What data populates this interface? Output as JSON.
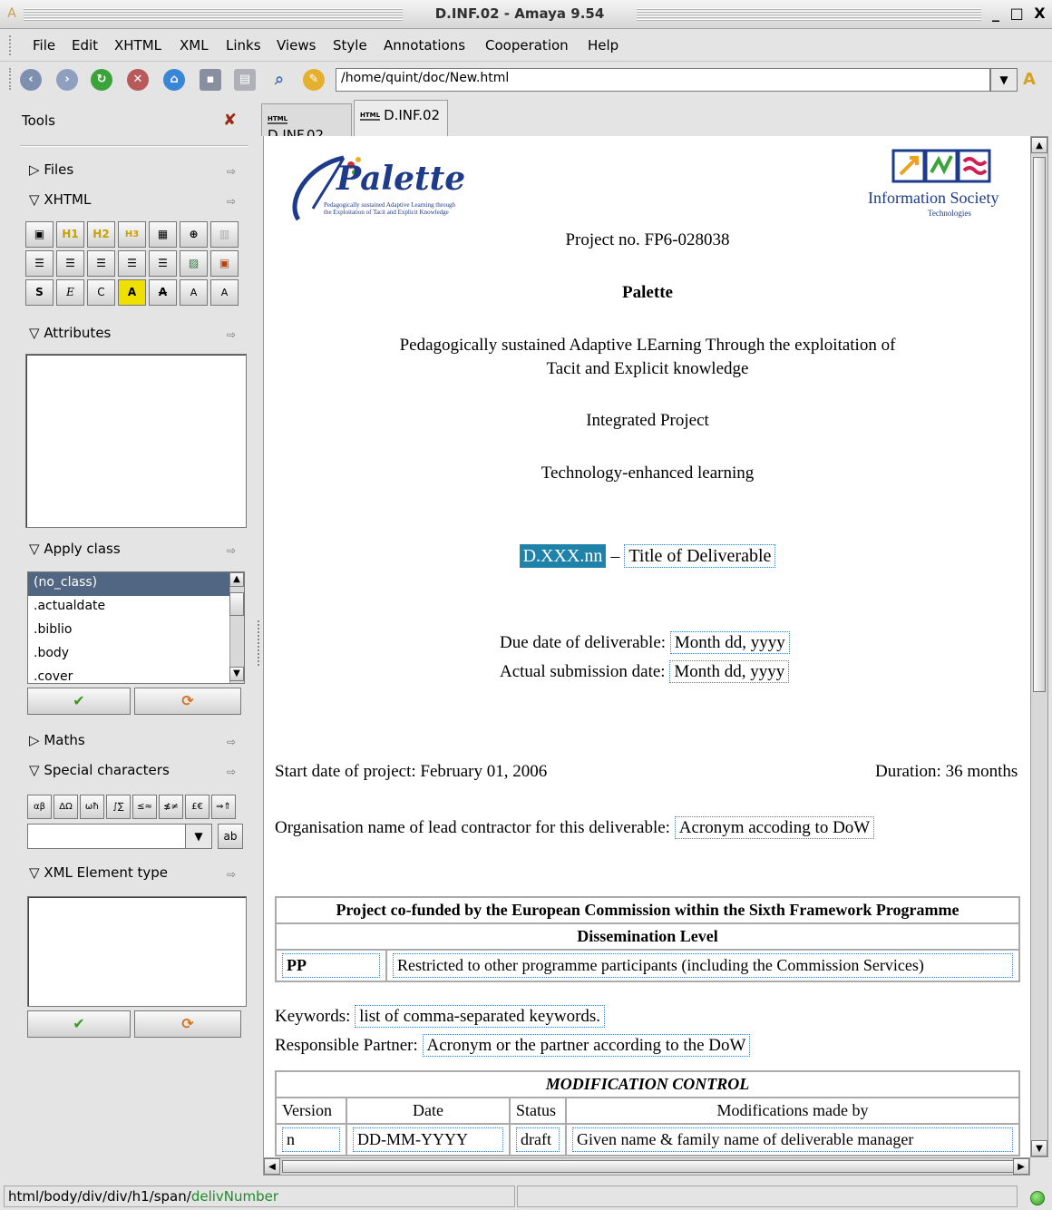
{
  "window": {
    "title": "D.INF.02 - Amaya 9.54",
    "controls": "_ □ X"
  },
  "menu": [
    "File",
    "Edit",
    "XHTML",
    "XML",
    "Links",
    "Views",
    "Style",
    "Annotations",
    "Cooperation",
    "Help"
  ],
  "toolbar": {
    "url": "/home/quint/doc/New.html",
    "icons": [
      "back-icon",
      "forward-icon",
      "reload-icon",
      "stop-icon",
      "home-icon",
      "save-icon",
      "print-icon",
      "find-icon",
      "spellcheck-icon",
      "style-icon"
    ]
  },
  "tools": {
    "title": "Tools",
    "sections": {
      "files": "Files",
      "xhtml": "XHTML",
      "attributes": "Attributes",
      "apply_class": "Apply class",
      "maths": "Maths",
      "special": "Special characters",
      "xml_type": "XML Element type"
    },
    "xhtml_buttons": [
      [
        "▣",
        "H1",
        "H2",
        "H3",
        "▦",
        "⊕",
        "▥"
      ],
      [
        "☰",
        "☰",
        "☰",
        "☰",
        "☰",
        "▨",
        "▣"
      ],
      [
        "S",
        "E",
        "C",
        "A",
        "A",
        "A",
        "A"
      ]
    ],
    "classes": [
      "(no_class)",
      ".actualdate",
      ".biblio",
      ".body",
      ".cover"
    ],
    "char_buttons": [
      "αβ",
      "ΔΩ",
      "ωħ",
      "∫∑",
      "≤≈",
      "≰≠",
      "£€",
      "⇒⇑"
    ]
  },
  "tabs": [
    "D.INF.02",
    "D.INF.02"
  ],
  "document": {
    "logo_left": "Palette",
    "logo_left_tagline1": "Pedagogically sustained Adaptive Learning through",
    "logo_left_tagline2": "the Exploitation of Tacit and Explicit Knowledge",
    "logo_right": "Information Society",
    "logo_right_sub": "Technologies",
    "project_no": "Project no. FP6-028038",
    "acronym": "Palette",
    "full_title_1": "Pedagogically sustained Adaptive LEarning Through the exploitation of",
    "full_title_2": "Tacit and Explicit knowledge",
    "type": "Integrated Project",
    "area": "Technology-enhanced learning",
    "deliv_number": "D.XXX.nn",
    "deliv_dash": "–",
    "deliv_title": "Title of Deliverable",
    "due_label": "Due date of deliverable:",
    "due_value": "Month dd, yyyy",
    "actual_label": "Actual submission date:",
    "actual_value": "Month dd, yyyy",
    "start_date": "Start date of project: February 01, 2006",
    "duration": "Duration: 36 months",
    "org_label": "Organisation name of lead contractor for this deliverable:",
    "org_value": "Acronym accoding to DoW",
    "cofunded": "Project co-funded by the European Commission within the Sixth Framework Programme",
    "dissemination": "Dissemination Level",
    "diss_code": "PP",
    "diss_text": "Restricted to other programme participants (including the Commission Services)",
    "keywords_label": "Keywords:",
    "keywords_value": "list of comma-separated keywords.",
    "partner_label": "Responsible Partner:",
    "partner_value": "Acronym or the partner according to the DoW",
    "mod_title": "MODIFICATION CONTROL",
    "mod_headers": [
      "Version",
      "Date",
      "Status",
      "Modifications made by"
    ],
    "mod_row": [
      "n",
      "DD-MM-YYYY",
      "draft",
      "Given name & family name of deliverable manager"
    ]
  },
  "status": {
    "path": "html/body/div/div/h1/span/",
    "path_leaf": "delivNumber"
  }
}
